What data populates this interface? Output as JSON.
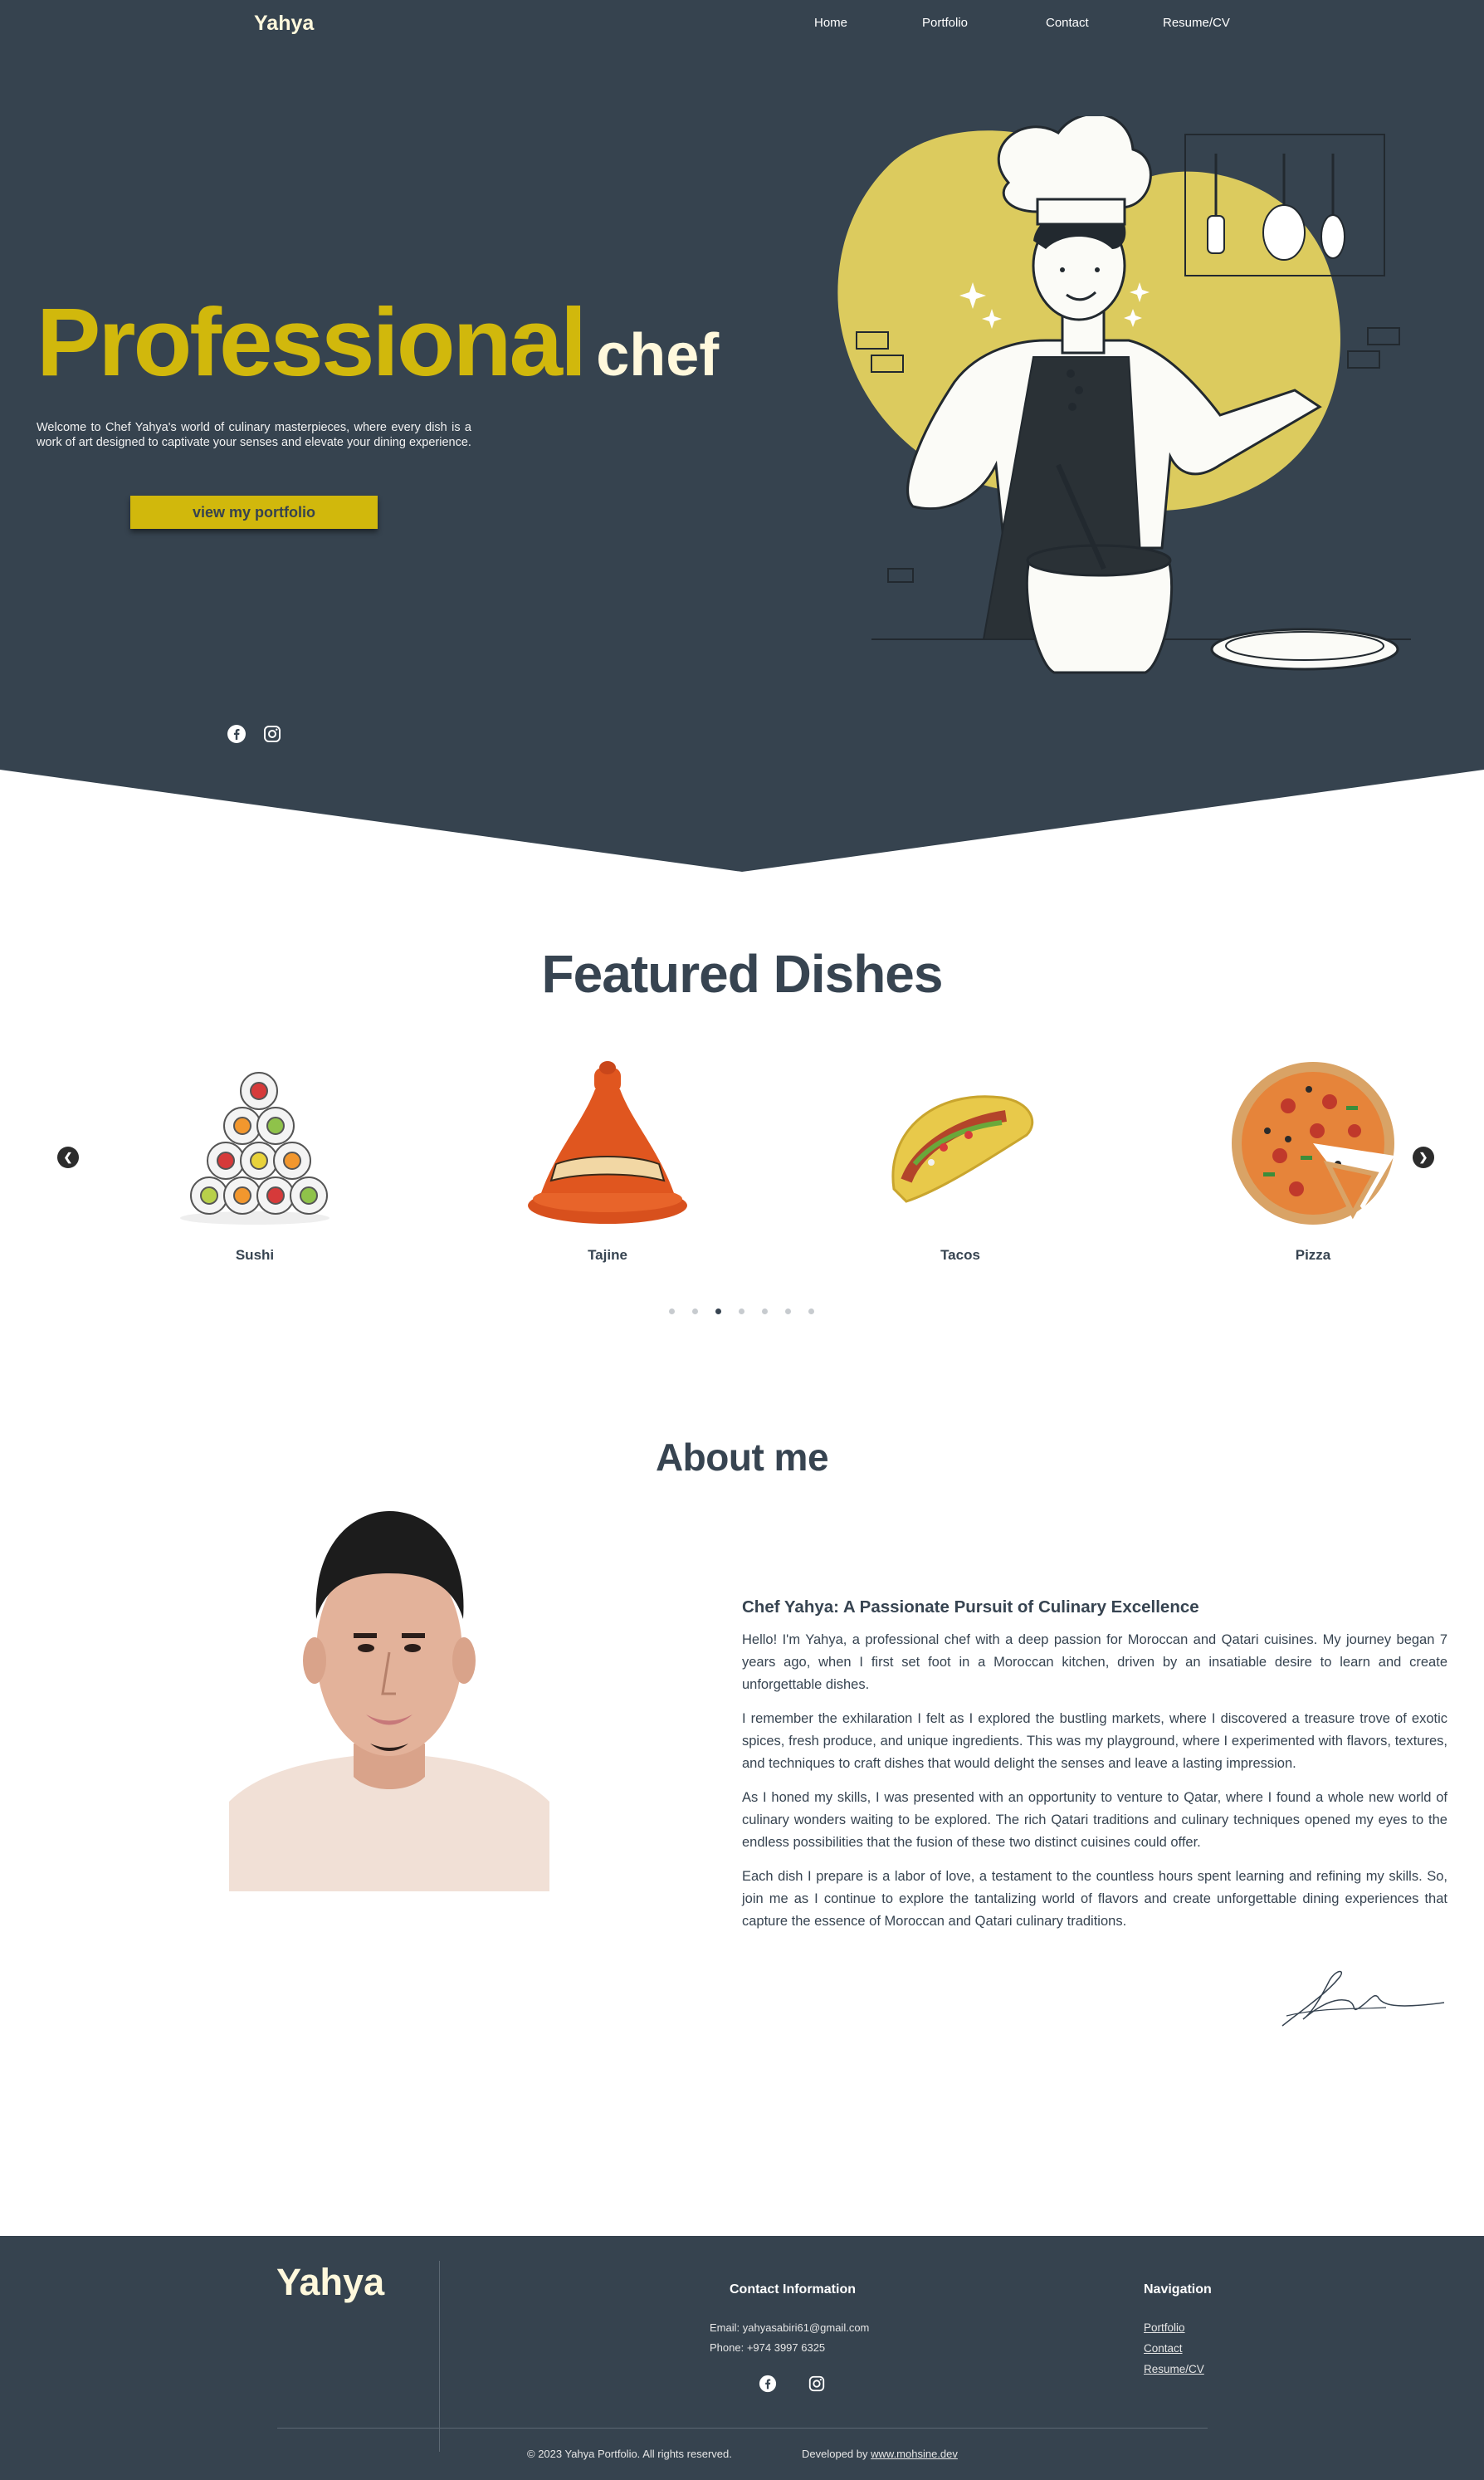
{
  "nav": {
    "logo": "Yahya",
    "links": [
      "Home",
      "Portfolio",
      "Contact",
      "Resume/CV"
    ]
  },
  "hero": {
    "title_main": "Professional",
    "title_sub": "chef",
    "description": "Welcome to Chef Yahya's world of culinary masterpieces, where every dish is a work of art designed to captivate your senses and elevate your dining experience.",
    "button_label": "view my portfolio",
    "social_icons": [
      "facebook-icon",
      "instagram-icon"
    ]
  },
  "featured": {
    "title": "Featured Dishes",
    "dishes": [
      {
        "name": "Sushi"
      },
      {
        "name": "Tajine"
      },
      {
        "name": "Tacos"
      },
      {
        "name": "Pizza"
      }
    ],
    "dot_count": 7,
    "active_dot": 2
  },
  "about": {
    "title": "About me",
    "heading": "Chef Yahya: A Passionate Pursuit of Culinary Excellence",
    "paragraphs": [
      "Hello! I'm Yahya, a professional chef with a deep passion for Moroccan and Qatari cuisines. My journey began 7 years ago, when I first set foot in a Moroccan kitchen, driven by an insatiable desire to learn and create unforgettable dishes.",
      "I remember the exhilaration I felt as I explored the bustling markets, where I discovered a treasure trove of exotic spices, fresh produce, and unique ingredients. This was my playground, where I experimented with flavors, textures, and techniques to craft dishes that would delight the senses and leave a lasting impression.",
      "As I honed my skills, I was presented with an opportunity to venture to Qatar, where I found a whole new world of culinary wonders waiting to be explored. The rich Qatari traditions and culinary techniques opened my eyes to the endless possibilities that the fusion of these two distinct cuisines could offer.",
      "Each dish I prepare is a labor of love, a testament to the countless hours spent learning and refining my skills. So, join me as I continue to explore the tantalizing world of flavors and create unforgettable dining experiences that capture the essence of Moroccan and Qatari culinary traditions."
    ]
  },
  "footer": {
    "logo": "Yahya",
    "contact_title": "Contact Information",
    "email": "Email: yahyasabiri61@gmail.com",
    "phone": "Phone: +974 3997 6325",
    "nav_title": "Navigation",
    "nav_items": [
      "Portfolio",
      "Contact",
      "Resume/CV"
    ],
    "copyright": "© 2023 Yahya Portfolio. All rights reserved.",
    "developed_by": "Developed by ",
    "developer_link": "www.mohsine.dev"
  },
  "colors": {
    "dark": "#36434f",
    "accent": "#d1b80c",
    "cream": "#fff8dc",
    "text": "#374451"
  }
}
